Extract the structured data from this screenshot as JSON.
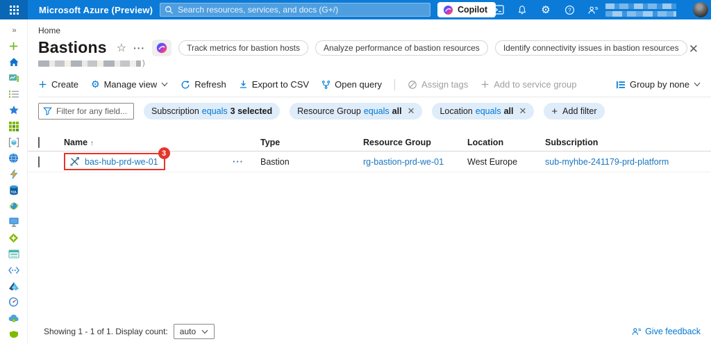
{
  "topbar": {
    "title": "Microsoft Azure (Preview)",
    "search_placeholder": "Search resources, services, and docs (G+/)",
    "copilot_label": "Copilot"
  },
  "breadcrumb": {
    "home": "Home"
  },
  "page": {
    "title": "Bastions",
    "suggestions": [
      "Track metrics for bastion hosts",
      "Analyze performance of bastion resources",
      "Identify connectivity issues in bastion resources"
    ]
  },
  "toolbar": {
    "create": "Create",
    "manage_view": "Manage view",
    "refresh": "Refresh",
    "export_csv": "Export to CSV",
    "open_query": "Open query",
    "assign_tags": "Assign tags",
    "add_to_service_group": "Add to service group",
    "group_by": "Group by none"
  },
  "filters": {
    "search_placeholder": "Filter for any field...",
    "pills": [
      {
        "field": "Subscription",
        "op": "equals",
        "value": "3 selected"
      },
      {
        "field": "Resource Group",
        "op": "equals",
        "value": "all"
      },
      {
        "field": "Location",
        "op": "equals",
        "value": "all"
      }
    ],
    "add_filter": "Add filter"
  },
  "table": {
    "columns": [
      "Name",
      "Type",
      "Resource Group",
      "Location",
      "Subscription"
    ],
    "sort_indicator": "↑",
    "rows": [
      {
        "name": "bas-hub-prd-we-01",
        "type": "Bastion",
        "resource_group": "rg-bastion-prd-we-01",
        "location": "West Europe",
        "subscription": "sub-myhbe-241179-prd-platform"
      }
    ],
    "annotation_badge": "3"
  },
  "footer": {
    "showing": "Showing 1 - 1 of 1. Display count:",
    "display_count": "auto",
    "give_feedback": "Give feedback"
  },
  "sidebar": {
    "items": [
      "collapse",
      "create",
      "home",
      "dashboard",
      "all-services",
      "favorites",
      "all-resources",
      "resource-groups",
      "app-services",
      "function-apps",
      "sql-databases",
      "cosmos-db",
      "virtual-machines",
      "load-balancers",
      "storage-accounts",
      "virtual-networks",
      "entra-id",
      "monitor",
      "advisor",
      "defender"
    ]
  },
  "colors": {
    "topbar_blue": "#0c7bd8",
    "accent_blue": "#0078d4",
    "link_blue": "#1a76c0",
    "pill_bg": "#dfecf9",
    "annotation_red": "#e5352a",
    "disabled_gray": "#a19f9d"
  }
}
